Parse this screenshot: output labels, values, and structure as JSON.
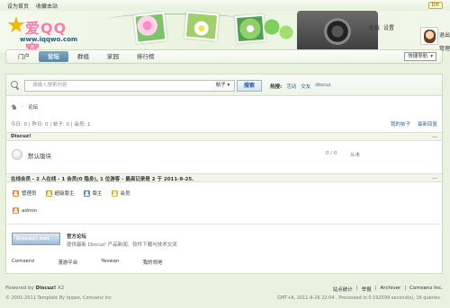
{
  "topbar": {
    "left_links": [
      "设为首页",
      "收藏本站"
    ],
    "diy_label": "DIY"
  },
  "header": {
    "logo_text": "爱QQ窝",
    "logo_url": "www.iqqwo.com",
    "user_links_row1": [
      "在线",
      "设置"
    ],
    "logout": "退出",
    "manage": "管理"
  },
  "nav": {
    "items": [
      "门户",
      "论坛",
      "群组",
      "家园",
      "排行榜"
    ],
    "active_index": 1,
    "quick_nav": "快捷导航"
  },
  "search": {
    "placeholder": "请输入搜索内容",
    "type": "帖子",
    "button": "搜索",
    "hot_label": "热搜:",
    "hot_words": [
      "活动",
      "交友",
      "discuz"
    ]
  },
  "breadcrumb": {
    "current": "论坛"
  },
  "stats": {
    "text": "今日: 0 | 昨日: 0 | 帖子: 0 | 会员: 1",
    "links": [
      "我的帖子",
      "最新回复"
    ]
  },
  "category": {
    "title": "Discuz!",
    "collapse": "—"
  },
  "forum": {
    "name": "默认版块",
    "count": "0 / 0",
    "last": "从未"
  },
  "online": {
    "summary": "在线会员 - 2 人在线 - 1 会员(0 隐身), 1 位游客 - 最高记录是 2 于 2011-9-25.",
    "legend": [
      {
        "label": "管理员",
        "color": "#e8893a"
      },
      {
        "label": "超级版主",
        "color": "#e0a23a"
      },
      {
        "label": "版主",
        "color": "#5f87b8"
      },
      {
        "label": "会员",
        "color": "#f0b23c"
      }
    ],
    "users": [
      {
        "name": "admin",
        "color": "#e8893a"
      }
    ]
  },
  "links": {
    "logo_text": "Discuz!.net",
    "title": "官方论坛",
    "desc": "提供最新 Discuz! 产品新闻、软件下载与技术交流",
    "text_links": [
      "Comsenz",
      "漫游平台",
      "Yeswan",
      "我的领地"
    ]
  },
  "footer": {
    "powered_prefix": "Powered by ",
    "powered_name": "Discuz!",
    "powered_ver": " X2",
    "copyright": "© 2001-2011 Template By Iqqwo, Comsenz Inc.",
    "right_links": [
      "站点统计",
      "|",
      "举报",
      "|",
      "Archiver",
      "|",
      "Comsenz Inc."
    ],
    "debug": "GMT+8, 2011-9-26 22:04 , Processed in 0.192599 second(s), 16 queries ."
  }
}
